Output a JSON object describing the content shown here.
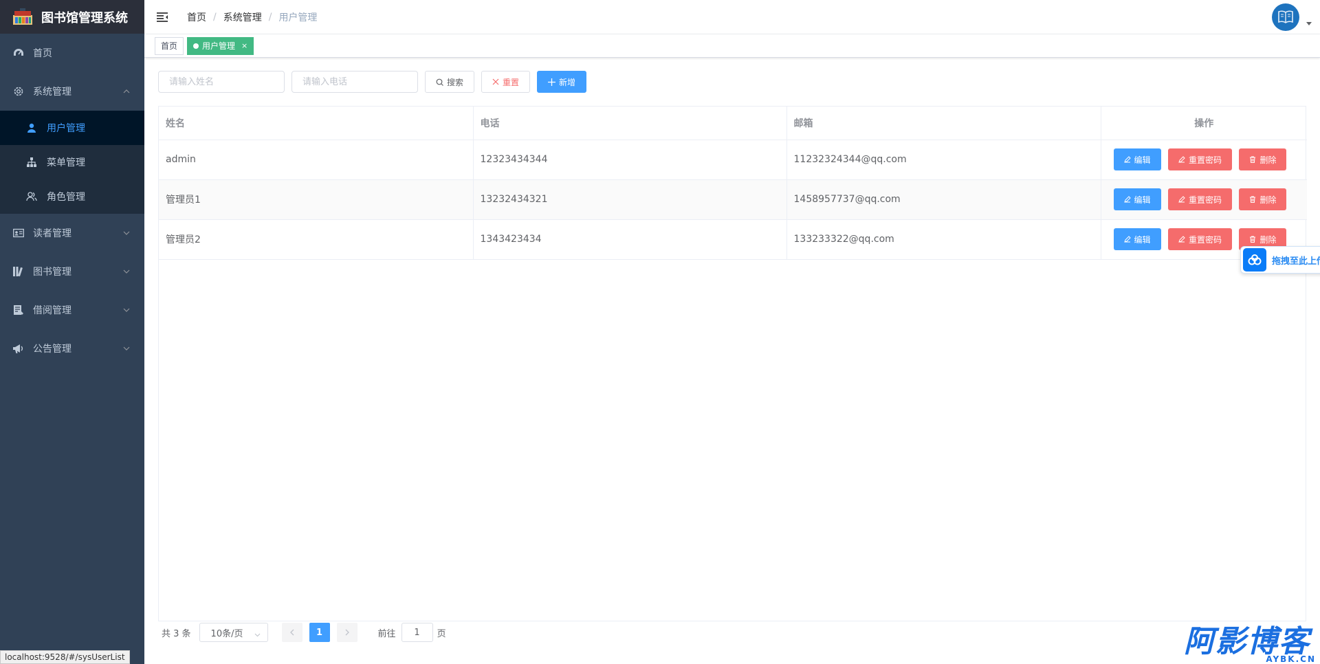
{
  "app": {
    "title": "图书馆管理系统"
  },
  "sidebar": {
    "items": [
      {
        "label": "首页",
        "icon": "dashboard-icon"
      },
      {
        "label": "系统管理",
        "icon": "gear-icon",
        "expanded": true,
        "children": [
          {
            "label": "用户管理",
            "icon": "user-icon",
            "active": true
          },
          {
            "label": "菜单管理",
            "icon": "tree-icon"
          },
          {
            "label": "角色管理",
            "icon": "peoples-icon"
          }
        ]
      },
      {
        "label": "读者管理",
        "icon": "id-card-icon"
      },
      {
        "label": "图书管理",
        "icon": "books-icon"
      },
      {
        "label": "借阅管理",
        "icon": "list-doc-icon"
      },
      {
        "label": "公告管理",
        "icon": "megaphone-icon"
      }
    ]
  },
  "header": {
    "breadcrumb": [
      "首页",
      "系统管理",
      "用户管理"
    ]
  },
  "tags": [
    {
      "label": "首页",
      "active": false
    },
    {
      "label": "用户管理",
      "active": true,
      "close": "×"
    }
  ],
  "toolbar": {
    "name_placeholder": "请输入姓名",
    "phone_placeholder": "请输入电话",
    "search_label": "搜索",
    "reset_label": "重置",
    "add_label": "新增"
  },
  "table": {
    "columns": [
      "姓名",
      "电话",
      "邮箱",
      "操作"
    ],
    "rows": [
      {
        "name": "admin",
        "phone": "12323434344",
        "email": "11232324344@qq.com"
      },
      {
        "name": "管理员1",
        "phone": "13232434321",
        "email": "1458957737@qq.com"
      },
      {
        "name": "管理员2",
        "phone": "1343423434",
        "email": "133233322@qq.com"
      }
    ],
    "actions": {
      "edit": "编辑",
      "reset_pwd": "重置密码",
      "delete": "删除"
    }
  },
  "pagination": {
    "total_text": "共 3 条",
    "page_size": "10条/页",
    "current_page": "1",
    "goto_label": "前往",
    "goto_value": "1",
    "page_suffix": "页"
  },
  "float_upload": {
    "label": "拖拽至此上传"
  },
  "statusbar": {
    "url": "localhost:9528/#/sysUserList"
  },
  "watermark": {
    "main": "阿影博客",
    "sub": "AYBK.CN"
  },
  "colors": {
    "sidebar_bg": "#304156",
    "primary": "#409eff",
    "danger": "#f56c6c",
    "tag_active": "#42b983"
  }
}
